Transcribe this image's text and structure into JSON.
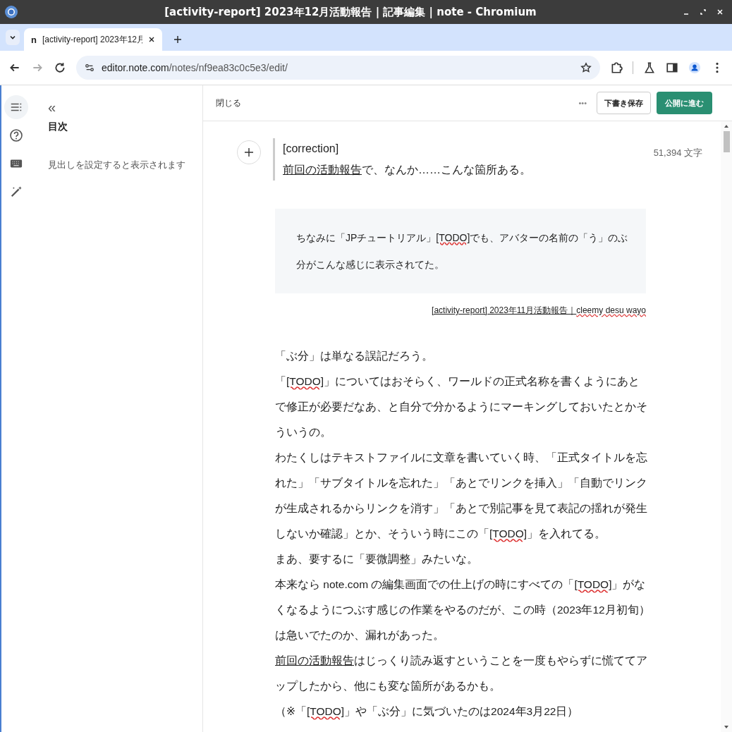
{
  "window": {
    "title": "[activity-report] 2023年12月活動報告 | 記事編集 | note - Chromium"
  },
  "tabs": [
    {
      "label": "[activity-report] 2023年12月",
      "favicon": "n",
      "selected": true
    }
  ],
  "address_bar": {
    "host": "editor.note.com",
    "path": "/notes/nf9ea83c0c5e3/edit/"
  },
  "sidebar": {
    "collapse": "«",
    "title": "目次",
    "empty_message": "見出しを設定すると表示されます",
    "rail": [
      {
        "kind": "toc",
        "selected": true
      },
      {
        "kind": "help",
        "selected": false
      },
      {
        "kind": "keyboard",
        "selected": false
      },
      {
        "kind": "magic",
        "selected": false
      }
    ]
  },
  "editor_header": {
    "close": "閉じる",
    "more": "•••",
    "save_draft": "下書き保存",
    "publish": "公開に進む"
  },
  "word_count": "51,394 文字",
  "quote": {
    "title": "[correction]",
    "parts": [
      {
        "kind": "link",
        "text": "前回の活動報告"
      },
      {
        "kind": "plain",
        "text": "で、なんか……こんな箇所ある。"
      }
    ]
  },
  "embed": {
    "lines": [
      [
        {
          "kind": "plain",
          "text": "ちなみに「JPチュートリアル」"
        },
        {
          "kind": "misspelled",
          "text": "[TODO]"
        },
        {
          "kind": "plain",
          "text": "でも、アバターの名前の「う」のぶ"
        }
      ],
      [
        {
          "kind": "plain",
          "text": "分がこんな感じに表示されてた。"
        }
      ]
    ],
    "citation": [
      {
        "kind": "link",
        "text": "[activity-report] 2023年11月活動報告｜"
      },
      {
        "kind": "misspelled-link",
        "text": "cleemy desu wayo"
      }
    ]
  },
  "paragraphs": [
    [
      {
        "kind": "plain",
        "text": "「ぶ分」は単なる誤記だろう。"
      }
    ],
    [
      {
        "kind": "plain",
        "text": "「"
      },
      {
        "kind": "misspelled",
        "text": "[TODO]"
      },
      {
        "kind": "plain",
        "text": "」についてはおそらく、ワールドの正式名称を書くようにあとで修正が必要だなあ、と自分で分かるようにマーキングしておいたとかそういうの。"
      }
    ],
    [
      {
        "kind": "plain",
        "text": "わたくしはテキストファイルに文章を書いていく時、「正式タイトルを忘れた」「サブタイトルを忘れた」「あとでリンクを挿入」「自動でリンクが生成されるからリンクを消す」「あとで別記事を見て表記の揺れが発生しないか確認」とか、そういう時にこの「"
      },
      {
        "kind": "misspelled",
        "text": "[TODO]"
      },
      {
        "kind": "plain",
        "text": "」を入れてる。"
      }
    ],
    [
      {
        "kind": "plain",
        "text": "まあ、要するに「要微調整」みたいな。"
      }
    ],
    [
      {
        "kind": "plain",
        "text": "本来なら note.com の編集画面での仕上げの時にすべての「"
      },
      {
        "kind": "misspelled",
        "text": "[TODO]"
      },
      {
        "kind": "plain",
        "text": "」がなくなるようにつぶす感じの作業をやるのだが、この時（2023年12月初旬）は急いでたのか、漏れがあった。"
      }
    ],
    [
      {
        "kind": "link",
        "text": "前回の活動報告"
      },
      {
        "kind": "plain",
        "text": "はじっくり読み返すということを一度もやらずに慌ててアップしたから、他にも変な箇所があるかも。"
      }
    ],
    [
      {
        "kind": "plain",
        "text": "（※「"
      },
      {
        "kind": "misspelled",
        "text": "[TODO]"
      },
      {
        "kind": "plain",
        "text": "」や「ぶ分」に気づいたのは2024年3月22日）"
      }
    ]
  ]
}
